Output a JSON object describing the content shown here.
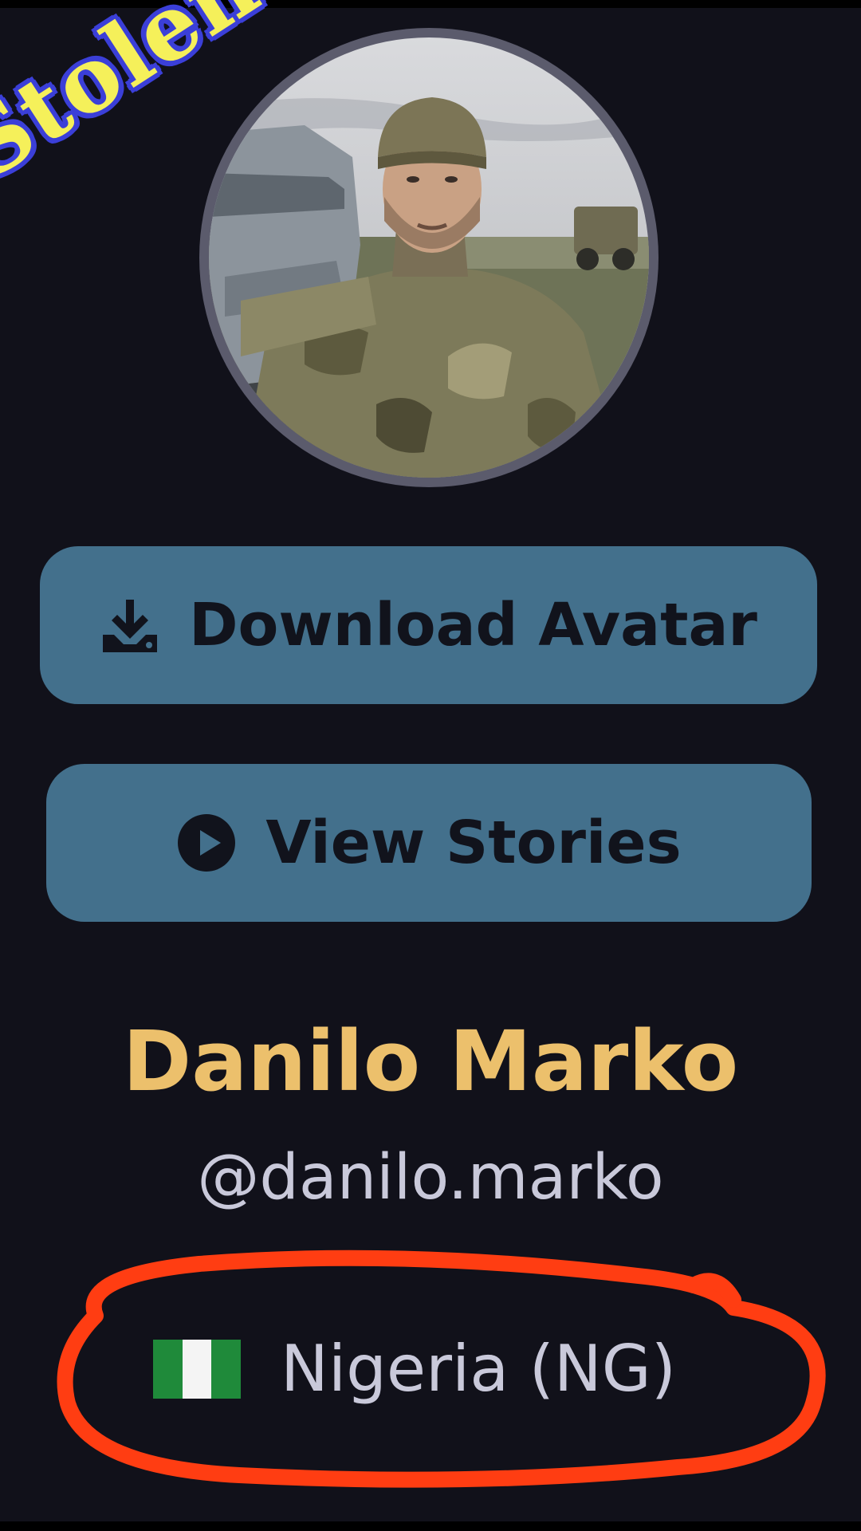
{
  "watermark": {
    "text": "Stolen",
    "fill_color": "#f5f05a",
    "outline_color": "#3b3fd8"
  },
  "avatar": {
    "alt": "profile avatar photo"
  },
  "buttons": {
    "download": {
      "label": "Download Avatar",
      "icon": "download-icon"
    },
    "stories": {
      "label": "View Stories",
      "icon": "play-circle-icon"
    }
  },
  "profile": {
    "name": "Danilo Marko",
    "handle": "@danilo.marko",
    "country": "Nigeria (NG)",
    "flag_icon": "nigeria-flag-icon"
  },
  "colors": {
    "background": "#11111a",
    "button": "#43708c",
    "name": "#ecc06c",
    "secondary_text": "#c9c9da",
    "annotation": "#ff3d12"
  }
}
